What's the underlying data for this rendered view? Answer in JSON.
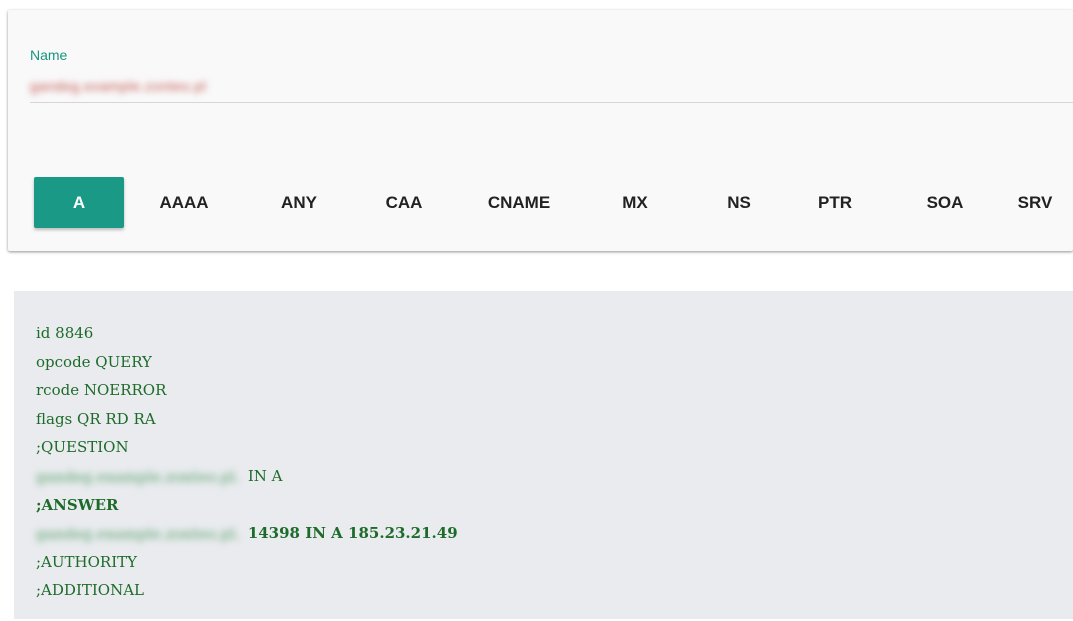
{
  "form": {
    "name_label": "Name",
    "name_value": "gandeg.example.zonteo.pl"
  },
  "record_types": [
    {
      "label": "A",
      "active": true
    },
    {
      "label": "AAAA",
      "active": false
    },
    {
      "label": "ANY",
      "active": false
    },
    {
      "label": "CAA",
      "active": false
    },
    {
      "label": "CNAME",
      "active": false
    },
    {
      "label": "MX",
      "active": false
    },
    {
      "label": "NS",
      "active": false
    },
    {
      "label": "PTR",
      "active": false
    },
    {
      "label": "SOA",
      "active": false
    },
    {
      "label": "SRV",
      "active": false
    }
  ],
  "result": {
    "id_line": "id 8846",
    "opcode_line": "opcode QUERY",
    "rcode_line": "rcode NOERROR",
    "flags_line": "flags QR RD RA",
    "question_header": ";QUESTION",
    "question_host": "gandeg.example.zonteo.pl.",
    "question_rest": "IN A",
    "answer_header": ";ANSWER",
    "answer_host": "gandeg.example.zonteo.pl.",
    "answer_rest": "14398 IN A 185.23.21.49",
    "authority_header": ";AUTHORITY",
    "additional_header": ";ADDITIONAL"
  },
  "colors": {
    "accent": "#1a9a86",
    "label_green": "#17957f",
    "result_text": "#1d6b2a",
    "result_bg": "#e9ebee"
  }
}
